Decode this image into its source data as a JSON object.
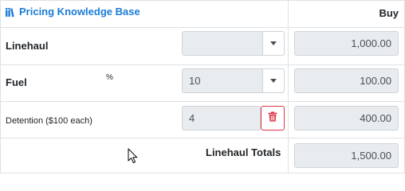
{
  "header": {
    "title": "Pricing Knowledge Base",
    "column_buy": "Buy"
  },
  "rows": [
    {
      "label": "Linehaul",
      "select_value": "",
      "buy_value": "1,000.00"
    },
    {
      "label": "Fuel",
      "unit": "%",
      "select_value": "10",
      "buy_value": "100.00"
    },
    {
      "label": "Detention ($100 each)",
      "quantity": "4",
      "buy_value": "400.00"
    }
  ],
  "totals": {
    "label": "Linehaul Totals",
    "value": "1,500.00"
  },
  "colors": {
    "link": "#1a7cd6",
    "danger": "#dc3545",
    "border": "#dee2e6",
    "input_bg": "#e9ecef"
  },
  "icons": {
    "books": "books-icon",
    "chevron": "chevron-down-icon",
    "trash": "trash-icon",
    "cursor": "mouse-cursor-icon"
  }
}
